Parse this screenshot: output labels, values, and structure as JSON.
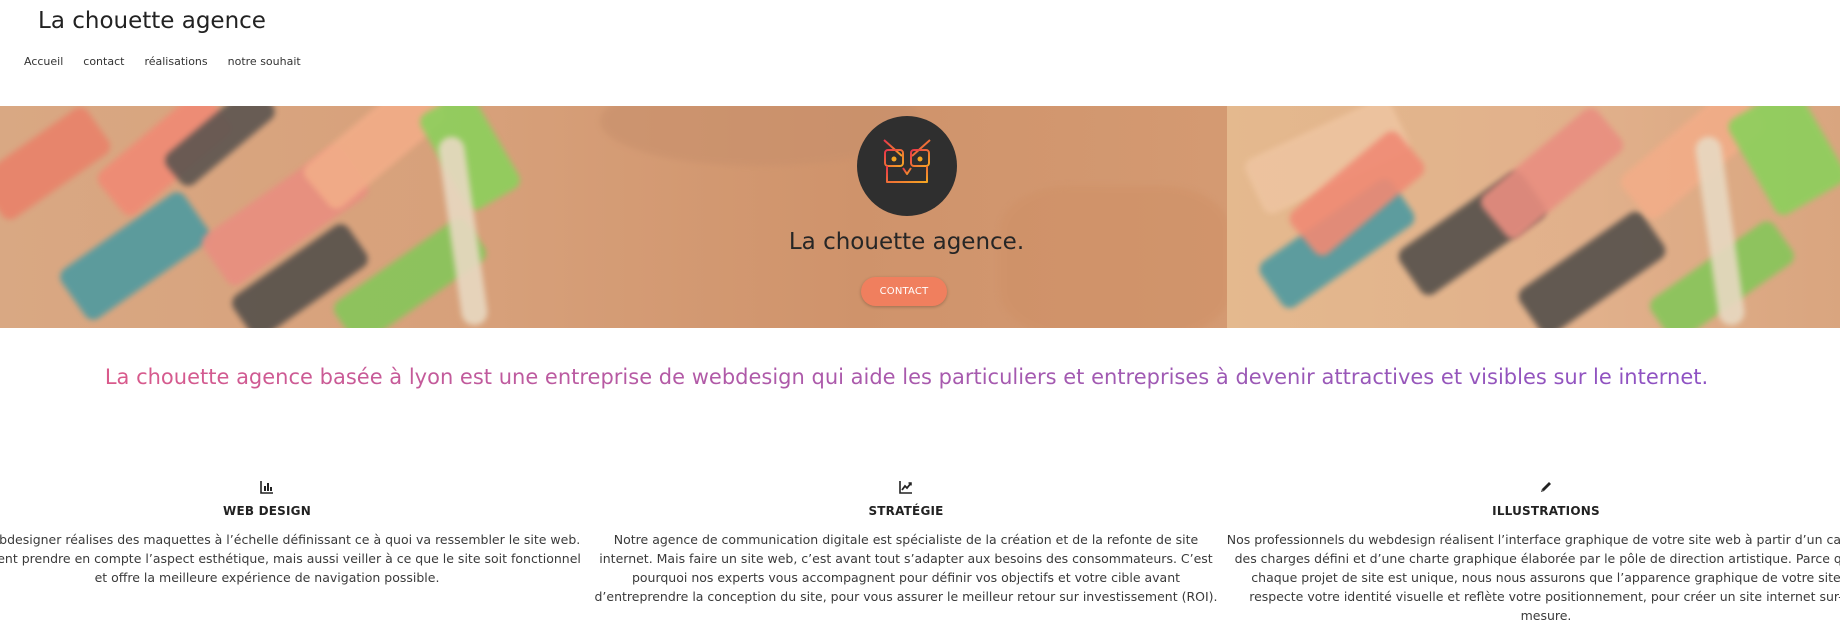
{
  "site": {
    "title": "La chouette agence"
  },
  "nav": {
    "items": [
      "Accueil",
      "contact",
      "réalisations",
      "notre souhait"
    ]
  },
  "hero": {
    "title": "La chouette agence.",
    "button_label": "CONTACT",
    "logo_icon": "owl-logo-icon"
  },
  "tagline": "La chouette agence basée à lyon est une entreprise de webdesign qui aide les particuliers et entreprises à devenir attractives et visibles sur le internet.",
  "features": [
    {
      "icon": "bar-chart-icon",
      "title": "WEB DESIGN",
      "text": "Nos webdesigner réalises des maquettes à l’échelle définissant ce à quoi va ressembler le site web. Ils doivent prendre en compte l’aspect esthétique, mais aussi veiller à ce que le site soit fonctionnel et offre la meilleure expérience de navigation possible."
    },
    {
      "icon": "line-chart-icon",
      "title": "STRATÉGIE",
      "text": "Notre agence de communication digitale est spécialiste de la création et de la refonte de site internet. Mais faire un site web, c’est avant tout s’adapter aux besoins des consommateurs. C’est pourquoi nos experts vous accompagnent pour définir vos objectifs et votre cible avant d’entreprendre la conception du site, pour vous assurer le meilleur retour sur investissement (ROI)."
    },
    {
      "icon": "pencil-icon",
      "title": "ILLUSTRATIONS",
      "text": "Nos professionnels du webdesign réalisent l’interface graphique de votre site web à partir d’un cahier des charges défini et d’une charte graphique élaborée par le pôle de direction artistique. Parce que chaque projet de site est unique, nous nous assurons que l’apparence graphique de votre site respecte votre identité visuelle et reflète votre positionnement, pour créer un site internet sur-mesure."
    }
  ],
  "colors": {
    "button": "#f07f5e",
    "gradient_start": "#e05a86",
    "gradient_end": "#8a4fc7",
    "logo_bg": "#2f2f2f"
  }
}
